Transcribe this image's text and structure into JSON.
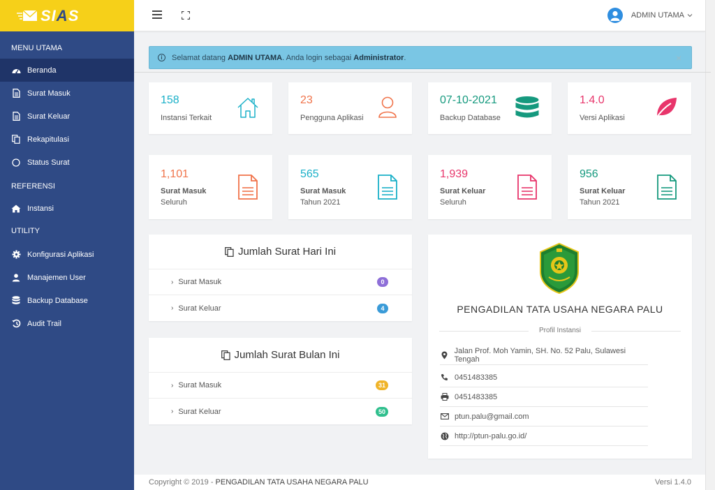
{
  "brand": {
    "name_part1": "SI",
    "name_part2": "A",
    "name_part3": "S"
  },
  "sidebar": {
    "sections": {
      "menu_utama": "MENU UTAMA",
      "referensi": "REFERENSI",
      "utility": "UTILITY"
    },
    "items": [
      {
        "label": "Beranda",
        "icon": "dashboard-icon"
      },
      {
        "label": "Surat Masuk",
        "icon": "document-icon"
      },
      {
        "label": "Surat Keluar",
        "icon": "document-icon"
      },
      {
        "label": "Rekapitulasi",
        "icon": "copy-icon"
      },
      {
        "label": "Status Surat",
        "icon": "circle-icon"
      },
      {
        "label": "Instansi",
        "icon": "home-icon"
      },
      {
        "label": "Konfigurasi Aplikasi",
        "icon": "gear-icon"
      },
      {
        "label": "Manajemen User",
        "icon": "user-icon"
      },
      {
        "label": "Backup Database",
        "icon": "database-icon"
      },
      {
        "label": "Audit Trail",
        "icon": "history-icon"
      }
    ]
  },
  "topbar": {
    "user_name": "ADMIN UTAMA"
  },
  "alert": {
    "prefix": "Selamat datang ",
    "user": "ADMIN UTAMA",
    "middle": ". Anda login sebagai ",
    "role": "Administrator",
    "suffix": ".",
    "close": "×"
  },
  "stats_row1": [
    {
      "value": "158",
      "label": "Instansi Terkait",
      "color": "#1ab0c8",
      "icon": "home-icon"
    },
    {
      "value": "23",
      "label": "Pengguna Aplikasi",
      "color": "#f0734a",
      "icon": "user-icon"
    },
    {
      "value": "07-10-2021",
      "label": "Backup Database",
      "color": "#15997e",
      "icon": "database-icon"
    },
    {
      "value": "1.4.0",
      "label": "Versi Aplikasi",
      "color": "#e8356b",
      "icon": "leaf-icon"
    }
  ],
  "stats_row2": [
    {
      "value": "1,101",
      "label": "Surat Masuk",
      "sub": "Seluruh",
      "color": "#f0734a"
    },
    {
      "value": "565",
      "label": "Surat Masuk",
      "sub": "Tahun 2021",
      "color": "#1ab0c8"
    },
    {
      "value": "1,939",
      "label": "Surat Keluar",
      "sub": "Seluruh",
      "color": "#e8356b"
    },
    {
      "value": "956",
      "label": "Surat Keluar",
      "sub": "Tahun 2021",
      "color": "#15997e"
    }
  ],
  "today_panel": {
    "title": "Jumlah Surat Hari Ini",
    "rows": [
      {
        "label": "Surat Masuk",
        "count": "0",
        "color": "#8e6fd8"
      },
      {
        "label": "Surat Keluar",
        "count": "4",
        "color": "#3a9bd8"
      }
    ]
  },
  "month_panel": {
    "title": "Jumlah Surat Bulan Ini",
    "rows": [
      {
        "label": "Surat Masuk",
        "count": "31",
        "color": "#f0b429"
      },
      {
        "label": "Surat Keluar",
        "count": "50",
        "color": "#2fbf8d"
      }
    ]
  },
  "profile": {
    "name": "PENGADILAN TATA USAHA NEGARA PALU",
    "subtitle": "Profil Instansi",
    "address": "Jalan Prof. Moh Yamin, SH. No. 52 Palu, Sulawesi Tengah",
    "phone": "0451483385",
    "fax": "0451483385",
    "email": "ptun.palu@gmail.com",
    "website": "http://ptun-palu.go.id/"
  },
  "footer": {
    "copyright": "Copyright © 2019 - ",
    "org": "PENGADILAN TATA USAHA NEGARA PALU",
    "version": "Versi 1.4.0"
  }
}
